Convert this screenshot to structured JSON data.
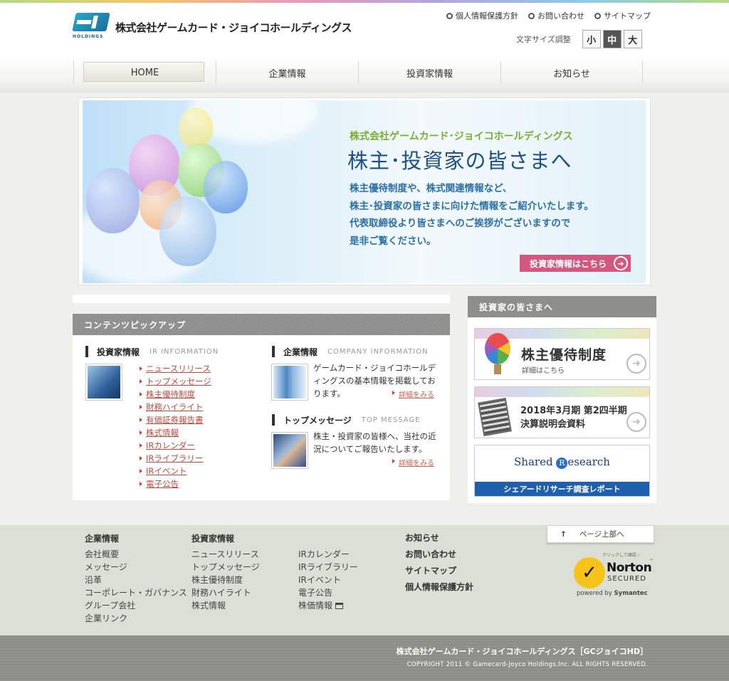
{
  "header": {
    "company_name": "株式会社ゲームカード・ジョイコホールディングス",
    "logo_caption": "HOLDINGS",
    "util_links": [
      "個人情報保護方針",
      "お問い合わせ",
      "サイトマップ"
    ],
    "font_size_label": "文字サイズ調整",
    "font_sizes": [
      "小",
      "中",
      "大"
    ],
    "font_size_selected": "中"
  },
  "nav": {
    "items": [
      "HOME",
      "企業情報",
      "投資家情報",
      "お知らせ"
    ],
    "active": "HOME"
  },
  "hero": {
    "company": "株式会社ゲームカード･ジョイコホールディングス",
    "title": "株主･投資家の皆さまへ",
    "lines": [
      "株主優待制度や、株式関連情報など、",
      "株主･投資家の皆さまに向けた情報をご紹介いたします。",
      "代表取締役より皆さまへのご挨拶がございますので",
      "是非ご覧ください。"
    ],
    "button": "投資家情報はこちら"
  },
  "pickup": {
    "title": "コンテンツピックアップ",
    "ir": {
      "title": "投資家情報",
      "title_en": "IR INFORMATION",
      "links": [
        "ニュースリリース",
        "トップメッセージ",
        "株主優待制度",
        "財務ハイライト",
        "有価証券報告書",
        "株式情報",
        "IRカレンダー",
        "IRライブラリー",
        "IRイベント",
        "電子公告"
      ]
    },
    "company": {
      "title": "企業情報",
      "title_en": "COMPANY INFORMATION",
      "desc": "ゲームカード・ジョイコホールディングスの基本情報を掲載しております。",
      "more": "詳細をみる"
    },
    "message": {
      "title": "トップメッセージ",
      "title_en": "TOP MESSAGE",
      "desc": "株主・投資家の皆様へ、当社の近況についてご報告いたします。",
      "more": "詳細をみる"
    }
  },
  "sidebar": {
    "title": "投資家の皆さまへ",
    "banners": {
      "yutai_title": "株主優待制度",
      "yutai_sub": "詳細はこちら",
      "results_line1": "2018年3月期 第2四半期",
      "results_line2": "決算説明会資料",
      "sr_logo_pre": "Shared ",
      "sr_logo_r": "R",
      "sr_logo_post": "esearch",
      "sr_bar": "シェアードリサーチ調査レポート"
    }
  },
  "footer": {
    "col1": {
      "head": "企業情報",
      "links": [
        "会社概要",
        "メッセージ",
        "沿革",
        "コーポレート・ガバナンス",
        "グループ会社",
        "企業リンク"
      ]
    },
    "col2": {
      "head": "投資家情報",
      "links": [
        "ニュースリリース",
        "トップメッセージ",
        "株主優待制度",
        "財務ハイライト",
        "株式情報"
      ]
    },
    "col3": {
      "links": [
        "IRカレンダー",
        "IRライブラリー",
        "IRイベント",
        "電子公告",
        "株価情報"
      ]
    },
    "col4": {
      "links": [
        "お知らせ",
        "お問い合わせ",
        "サイトマップ",
        "個人情報保護方針"
      ]
    },
    "page_top": "ページ上部へ",
    "norton": {
      "click": "クリックして確認 ›",
      "name": "Norton",
      "secured": "SECURED",
      "powered_pre": "powered by ",
      "powered_brand": "Symantec",
      "tm": "™"
    },
    "copyright_name": "株式会社ゲームカード・ジョイコホールディングス［GCジョイコHD］",
    "copyright": "COPYRIGHT 2011 © Gamecard-Joyco Holdings,Inc. ALL RIGHTS RESERVED."
  },
  "colors": {
    "accent_green": "#7cab2f",
    "title_blue": "#1f4f88",
    "link_red": "#b94b3f",
    "button_pink": "#d2587f"
  }
}
